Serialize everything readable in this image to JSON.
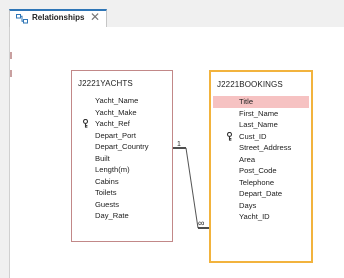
{
  "tab": {
    "icon": "relationships-icon",
    "label": "Relationships",
    "close_glyph": "✕"
  },
  "tables": [
    {
      "title": "J2221YACHTS",
      "fields": [
        {
          "label": "Yacht_Name",
          "key": false
        },
        {
          "label": "Yacht_Make",
          "key": false
        },
        {
          "label": "Yacht_Ref",
          "key": true
        },
        {
          "label": "Depart_Port",
          "key": false
        },
        {
          "label": "Depart_Country",
          "key": false
        },
        {
          "label": "Built",
          "key": false
        },
        {
          "label": "Length(m)",
          "key": false
        },
        {
          "label": "Cabins",
          "key": false
        },
        {
          "label": "Toilets",
          "key": false
        },
        {
          "label": "Guests",
          "key": false
        },
        {
          "label": "Day_Rate",
          "key": false
        }
      ]
    },
    {
      "title": "J2221BOOKINGS",
      "selected": true,
      "fields": [
        {
          "label": "Title",
          "key": false,
          "selected": true
        },
        {
          "label": "First_Name",
          "key": false
        },
        {
          "label": "Last_Name",
          "key": false
        },
        {
          "label": "Cust_ID",
          "key": true
        },
        {
          "label": "Street_Address",
          "key": false
        },
        {
          "label": "Area",
          "key": false
        },
        {
          "label": "Post_Code",
          "key": false
        },
        {
          "label": "Telephone",
          "key": false
        },
        {
          "label": "Depart_Date",
          "key": false
        },
        {
          "label": "Days",
          "key": false
        },
        {
          "label": "Yacht_ID",
          "key": false
        }
      ]
    }
  ],
  "relationship": {
    "one_label": "1",
    "many_label": "∞"
  },
  "colors": {
    "accent": "#2e75b6",
    "selected_table_border": "#f2b33d",
    "selected_field": "#f6c2c2"
  }
}
